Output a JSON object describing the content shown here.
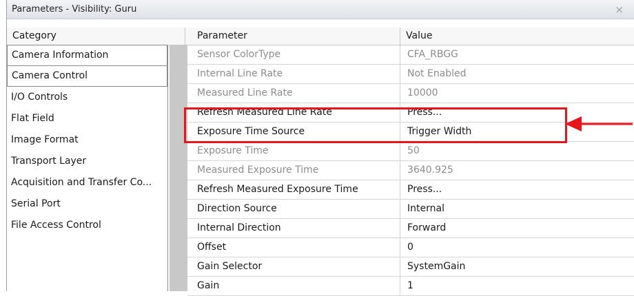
{
  "window": {
    "title": "Parameters - Visibility: Guru",
    "close_glyph": "×"
  },
  "columns": {
    "category": "Category",
    "parameter": "Parameter",
    "value": "Value"
  },
  "categories": [
    "Camera Information",
    "Camera Control",
    "I/O Controls",
    "Flat Field",
    "Image Format",
    "Transport Layer",
    "Acquisition and Transfer Co...",
    "Serial Port",
    "File Access Control"
  ],
  "parameters": [
    {
      "name": "Sensor ColorType",
      "value": "CFA_RBGG",
      "enabled": false
    },
    {
      "name": "Internal Line Rate",
      "value": "Not Enabled",
      "enabled": false
    },
    {
      "name": "Measured Line Rate",
      "value": "10000",
      "enabled": false
    },
    {
      "name": "Refresh Measured Line Rate",
      "value": "Press...",
      "enabled": true
    },
    {
      "name": "Exposure Time Source",
      "value": "Trigger Width",
      "enabled": true
    },
    {
      "name": "Exposure Time",
      "value": "50",
      "enabled": false
    },
    {
      "name": "Measured Exposure Time",
      "value": "3640.925",
      "enabled": false
    },
    {
      "name": "Refresh Measured Exposure Time",
      "value": "Press...",
      "enabled": true
    },
    {
      "name": "Direction Source",
      "value": "Internal",
      "enabled": true
    },
    {
      "name": "Internal Direction",
      "value": "Forward",
      "enabled": true
    },
    {
      "name": "Offset",
      "value": "0",
      "enabled": true
    },
    {
      "name": "Gain Selector",
      "value": "SystemGain",
      "enabled": true
    },
    {
      "name": "Gain",
      "value": "1",
      "enabled": true
    }
  ],
  "annotation": {
    "color": "#e8141b"
  }
}
